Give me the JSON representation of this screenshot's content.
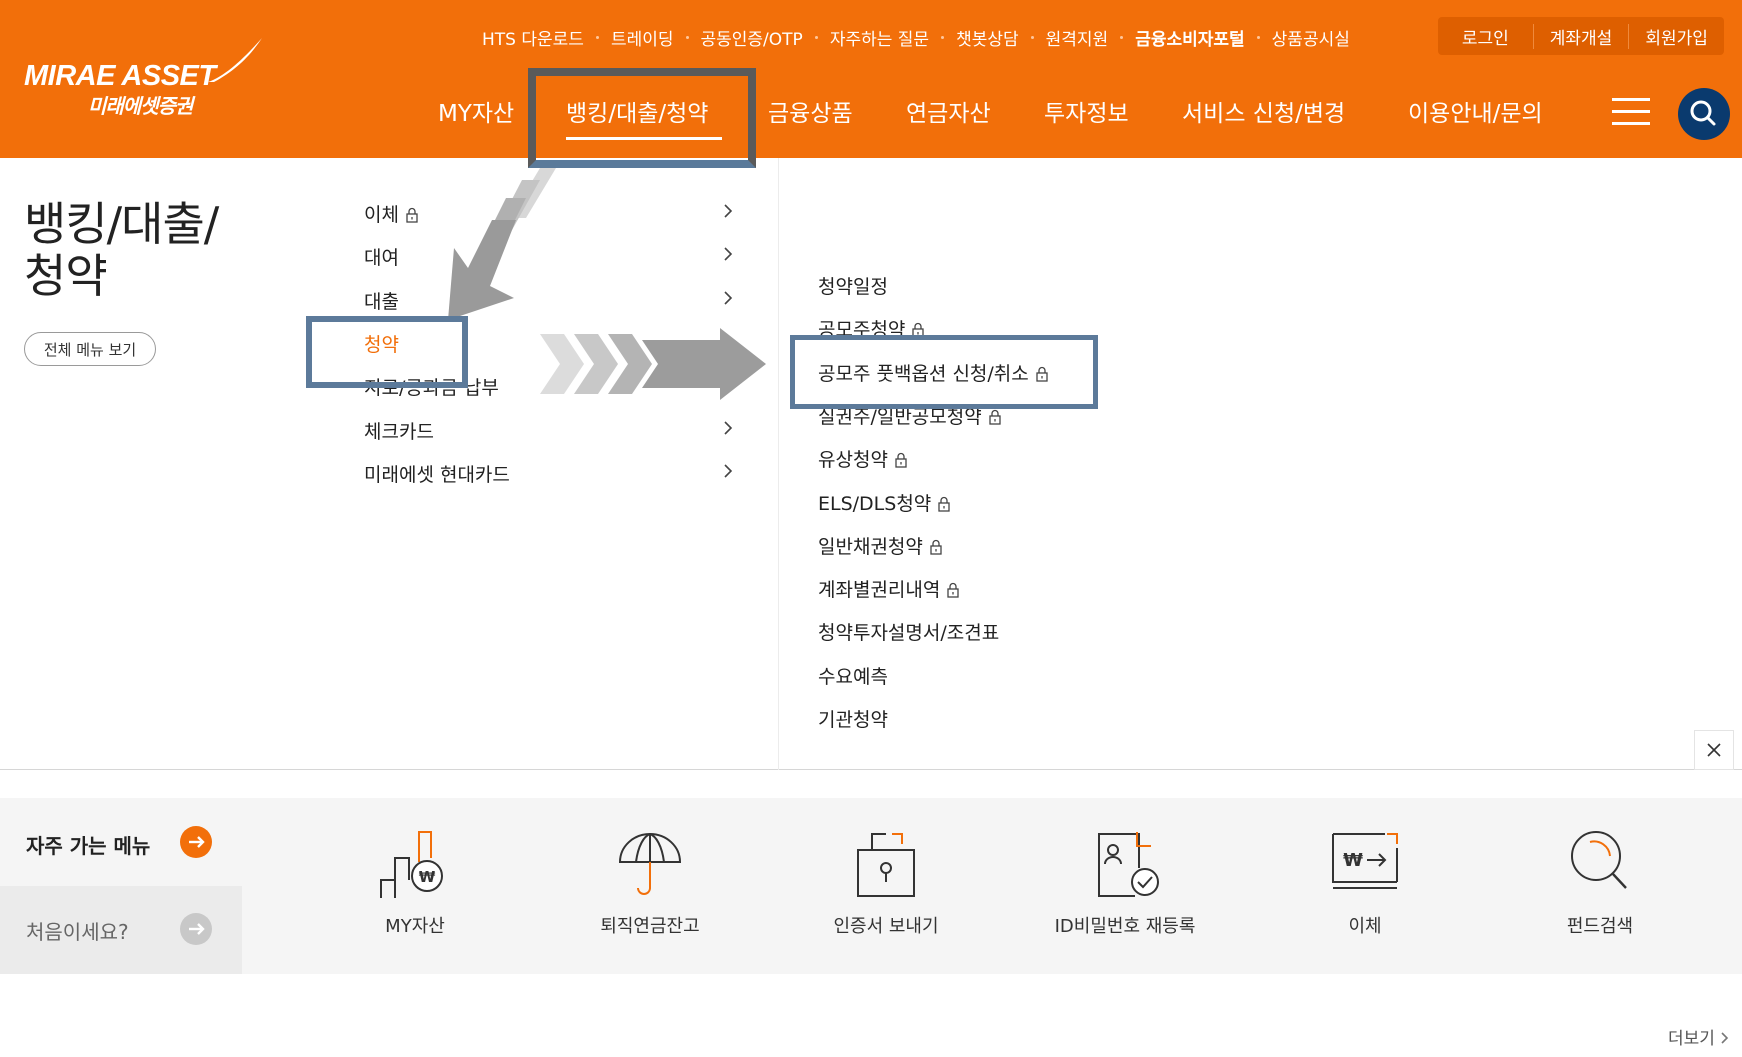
{
  "brand": {
    "logo_text": "MIRAE ASSET",
    "logo_sub": "미래에셋증권",
    "primary_color": "#f26f0a",
    "accent_color": "#0a3a6e"
  },
  "utility_nav": [
    {
      "label": "HTS 다운로드"
    },
    {
      "label": "트레이딩"
    },
    {
      "label": "공동인증/OTP"
    },
    {
      "label": "자주하는 질문"
    },
    {
      "label": "챗봇상담"
    },
    {
      "label": "원격지원"
    },
    {
      "label": "금융소비자포털",
      "bold": true
    },
    {
      "label": "상품공시실"
    }
  ],
  "auth": {
    "login": "로그인",
    "open_account": "계좌개설",
    "signup": "회원가입"
  },
  "gnb": [
    {
      "label": "MY자산"
    },
    {
      "label": "뱅킹/대출/청약",
      "active": true
    },
    {
      "label": "금융상품"
    },
    {
      "label": "연금자산"
    },
    {
      "label": "투자정보"
    },
    {
      "label": "서비스 신청/변경"
    },
    {
      "label": "이용안내/문의"
    }
  ],
  "icons": {
    "menu": "hamburger-icon",
    "search": "search-icon",
    "lock": "lock-icon",
    "chevron": "chevron-right-icon",
    "close": "close-icon"
  },
  "menu": {
    "section_title": "뱅킹/대출/\n청약",
    "all_menu_button": "전체 메뉴 보기",
    "level2": [
      {
        "label": "이체",
        "lock": true,
        "has_sub": true
      },
      {
        "label": "대여",
        "lock": false,
        "has_sub": true
      },
      {
        "label": "대출",
        "lock": false,
        "has_sub": true
      },
      {
        "label": "청약",
        "lock": false,
        "has_sub": false,
        "active": true
      },
      {
        "label": "지로/공과금 납부",
        "lock": false,
        "has_sub": false
      },
      {
        "label": "체크카드",
        "lock": false,
        "has_sub": true
      },
      {
        "label": "미래에셋 현대카드",
        "lock": false,
        "has_sub": true
      }
    ],
    "level3": [
      {
        "label": "청약일정",
        "lock": false
      },
      {
        "label": "공모주청약",
        "lock": true
      },
      {
        "label": "공모주 풋백옵션 신청/취소",
        "lock": true
      },
      {
        "label": "실권주/일반공모청약",
        "lock": true
      },
      {
        "label": "유상청약",
        "lock": true
      },
      {
        "label": "ELS/DLS청약",
        "lock": true
      },
      {
        "label": "일반채권청약",
        "lock": true
      },
      {
        "label": "계좌별권리내역",
        "lock": true
      },
      {
        "label": "청약투자설명서/조견표",
        "lock": false
      },
      {
        "label": "수요예측",
        "lock": false
      },
      {
        "label": "기관청약",
        "lock": false
      }
    ]
  },
  "quick_menu": {
    "title": "자주 가는 메뉴",
    "first_visit": "처음이세요?",
    "items": [
      {
        "label": "MY자산",
        "icon": "building-won-icon"
      },
      {
        "label": "퇴직연금잔고",
        "icon": "umbrella-icon"
      },
      {
        "label": "인증서 보내기",
        "icon": "certificate-lock-icon"
      },
      {
        "label": "ID비밀번호 재등록",
        "icon": "id-document-check-icon"
      },
      {
        "label": "이체",
        "icon": "won-transfer-icon"
      },
      {
        "label": "펀드검색",
        "icon": "magnifier-icon"
      }
    ]
  },
  "footer": {
    "more_label": "더보기"
  }
}
